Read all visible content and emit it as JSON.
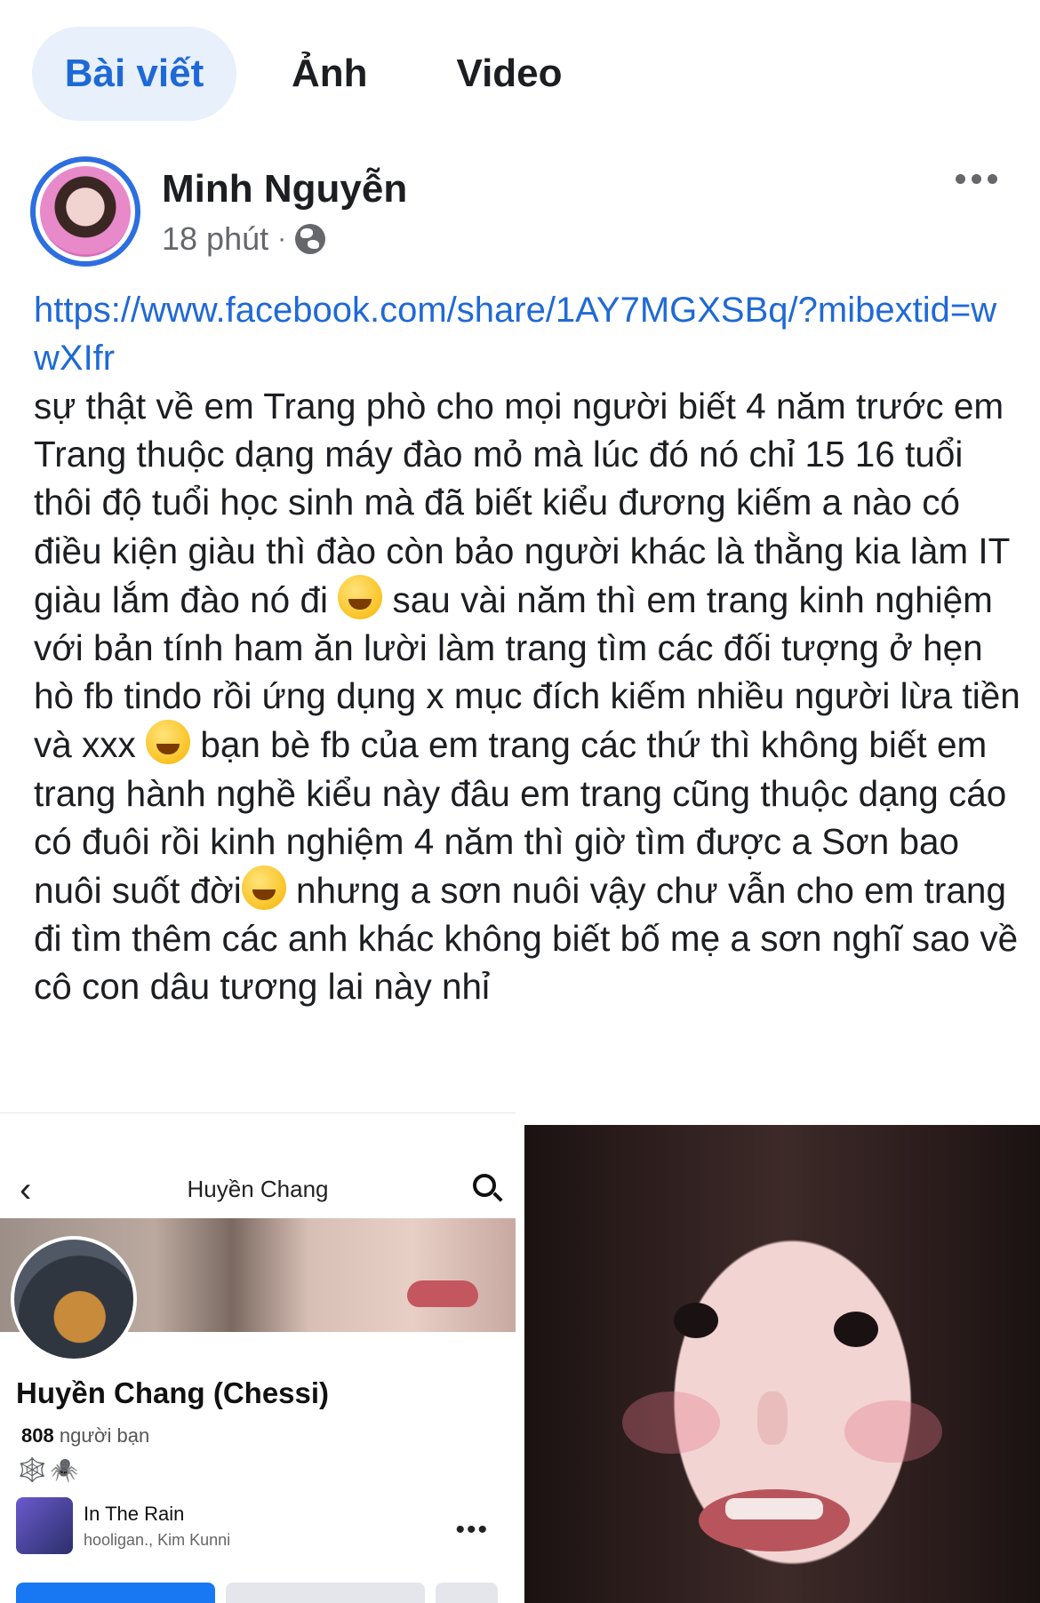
{
  "tabs": [
    {
      "label": "Bài viết",
      "active": true
    },
    {
      "label": "Ảnh",
      "active": false
    },
    {
      "label": "Video",
      "active": false
    }
  ],
  "post": {
    "author": "Minh Nguyễn",
    "time": "18 phút",
    "separator": "·",
    "privacy_icon": "globe-icon",
    "link": "https://www.facebook.com/share/1AY7MGXSBq/?mibextid=wwXIfr",
    "text_part1": "sự thật về em Trang phò cho mọi người biết 4 năm trước em Trang thuộc dạng máy đào mỏ mà lúc đó nó chỉ 15 16 tuổi thôi độ tuổi học sinh mà đã biết kiểu đương kiếm a nào có điều kiện giàu thì đào còn bảo người khác là thằng kia làm IT giàu lắm đào nó đi",
    "text_part2": "sau vài năm thì em trang kinh nghiệm với bản tính ham ăn lười làm trang tìm các đối tượng ở hẹn hò fb tindo rồi ứng dụng x mục đích kiếm nhiều người lừa tiền và xxx",
    "text_part3": "bạn bè fb của em trang các thứ thì không biết em trang hành nghề kiểu này đâu em trang cũng thuộc dạng cáo có đuôi rồi kinh nghiệm 4 năm thì giờ tìm được a Sơn bao nuôi suốt đời",
    "text_part4": "nhưng a sơn nuôi vậy chư vẫn cho em trang đi tìm thêm các anh khác không biết bố mẹ a sơn nghĩ sao về cô con dâu tương lai này nhỉ"
  },
  "screenshot_profile": {
    "nav_title": "Huyền Chang",
    "name": "Huyền Chang (Chessi)",
    "friends_count": "808",
    "friends_label": "người bạn",
    "badges": "🕸️🕷️",
    "song_title": "In The Rain",
    "song_artist": "hooligan., Kim Kunni",
    "more": "•••",
    "back": "‹"
  },
  "colors": {
    "accent": "#1f69d6",
    "active_tab_bg": "#e7f0fb",
    "muted": "#65676b"
  }
}
